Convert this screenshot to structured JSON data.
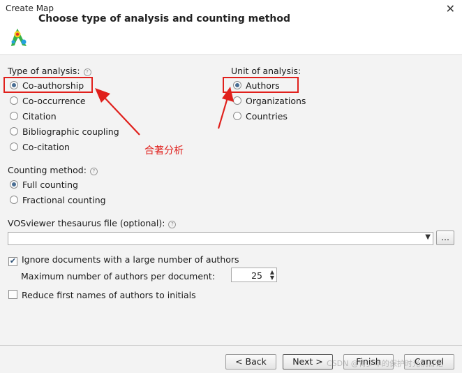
{
  "window": {
    "title": "Create Map",
    "close_glyph": "✕"
  },
  "header": {
    "title": "Choose type of analysis and counting method",
    "icon": "vosviewer-logo-icon"
  },
  "type_of_analysis": {
    "label": "Type of analysis:",
    "options": [
      "Co-authorship",
      "Co-occurrence",
      "Citation",
      "Bibliographic coupling",
      "Co-citation"
    ],
    "selected": "Co-authorship"
  },
  "unit_of_analysis": {
    "label": "Unit of analysis:",
    "options": [
      "Authors",
      "Organizations",
      "Countries"
    ],
    "selected": "Authors"
  },
  "annotation": {
    "text": "合著分析",
    "color": "#e0201c"
  },
  "counting_method": {
    "label": "Counting method:",
    "options": [
      "Full counting",
      "Fractional counting"
    ],
    "selected": "Full counting"
  },
  "thesaurus": {
    "label": "VOSviewer thesaurus file (optional):",
    "value": "",
    "browse_label": "..."
  },
  "options": {
    "ignore_docs_label": "Ignore documents with a large number of authors",
    "ignore_docs_checked": true,
    "max_authors_label": "Maximum number of authors per document:",
    "max_authors_value": "25",
    "reduce_names_label": "Reduce first names of authors to initials",
    "reduce_names_checked": false
  },
  "footer": {
    "back_label": "< Back",
    "next_label": "Next >",
    "finish_label": "Finish",
    "cancel_label": "Cancel"
  },
  "watermark": "CSDN @青少年的保护时光机日记",
  "help_glyph": "?",
  "colors": {
    "accent": "#4a6e93",
    "highlight": "#e0201c"
  }
}
